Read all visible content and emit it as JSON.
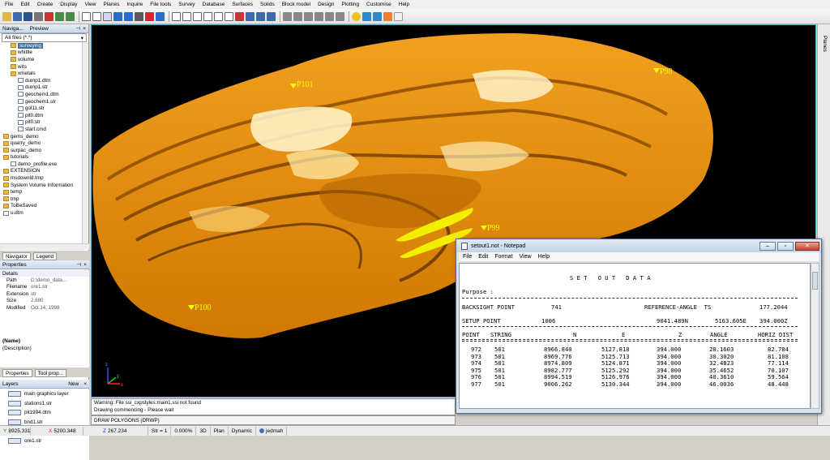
{
  "menu": [
    "File",
    "Edit",
    "Create",
    "Display",
    "View",
    "Planes",
    "Inquire",
    "File tools",
    "Survey",
    "Database",
    "Surfaces",
    "Solids",
    "Block model",
    "Design",
    "Plotting",
    "Customise",
    "Help"
  ],
  "navigator": {
    "title": "Naviga...",
    "preview_tab": "Preview",
    "filter": "All files (*.*)",
    "items": [
      {
        "label": "surveying",
        "kind": "folder",
        "indent": 1,
        "selected": true
      },
      {
        "label": "whittle",
        "kind": "folder",
        "indent": 1
      },
      {
        "label": "volume",
        "kind": "folder",
        "indent": 1
      },
      {
        "label": "wits",
        "kind": "folder",
        "indent": 1
      },
      {
        "label": "xmetals",
        "kind": "folder",
        "indent": 1
      },
      {
        "label": "dump1.dtm",
        "kind": "file",
        "indent": 2
      },
      {
        "label": "dump1.str",
        "kind": "file",
        "indent": 2
      },
      {
        "label": "geochem1.dtm",
        "kind": "file",
        "indent": 2
      },
      {
        "label": "geochem1.str",
        "kind": "file",
        "indent": 2
      },
      {
        "label": "gol11.str",
        "kind": "file",
        "indent": 2
      },
      {
        "label": "pit0.dtm",
        "kind": "file",
        "indent": 2
      },
      {
        "label": "pit0.str",
        "kind": "file",
        "indent": 2
      },
      {
        "label": "start.cmd",
        "kind": "file",
        "indent": 2
      },
      {
        "label": "gems_demo",
        "kind": "folder",
        "indent": 0
      },
      {
        "label": "quarry_demo",
        "kind": "folder",
        "indent": 0
      },
      {
        "label": "surpac_demo",
        "kind": "folder",
        "indent": 0
      },
      {
        "label": "tutorials",
        "kind": "folder",
        "indent": 0
      },
      {
        "label": "demo_profile.exe",
        "kind": "file",
        "indent": 1
      },
      {
        "label": "EXTENSION",
        "kind": "folder",
        "indent": 0
      },
      {
        "label": "msdownld.tmp",
        "kind": "folder",
        "indent": 0
      },
      {
        "label": "System Volume Information",
        "kind": "folder",
        "indent": 0
      },
      {
        "label": "temp",
        "kind": "folder",
        "indent": 0
      },
      {
        "label": "tmp",
        "kind": "folder",
        "indent": 0
      },
      {
        "label": "ToBeSaved",
        "kind": "folder",
        "indent": 0
      },
      {
        "label": "u.dtm",
        "kind": "file",
        "indent": 0
      }
    ]
  },
  "nav_tabs": [
    "Navigator",
    "Legend"
  ],
  "properties": {
    "title": "Properties",
    "section": "Details",
    "rows": [
      {
        "k": "Path",
        "v": "D:\\demo_data..."
      },
      {
        "k": "Filename",
        "v": "ore1.str"
      },
      {
        "k": "Extension",
        "v": "str"
      },
      {
        "k": "Size",
        "v": "2,680"
      },
      {
        "k": "Modified",
        "v": "Oct 14, 1998"
      }
    ],
    "name_label": "(Name)",
    "desc_label": "(Description)"
  },
  "prop_tabs": [
    "Properties",
    "Tool prop..."
  ],
  "layers": {
    "title": "Layers",
    "new_label": "New",
    "items": [
      {
        "label": "main graphics layer",
        "selected": false
      },
      {
        "label": "stations1.str",
        "selected": false
      },
      {
        "label": "pit1994.dtm",
        "selected": false
      },
      {
        "label": "bnd1.str",
        "selected": false
      },
      {
        "label": "new2.str",
        "selected": true
      },
      {
        "label": "ore1.str",
        "selected": false
      }
    ]
  },
  "viewport": {
    "point_labels": [
      "P101",
      "P98",
      "P99",
      "P100"
    ],
    "axis_labels": [
      "z",
      "y",
      "x"
    ]
  },
  "right_strip": {
    "label": "Planes"
  },
  "console": {
    "line1": "Warning: File ssi_cxpstyles:main1.ssi not found",
    "line2": "Drawing commencing - Please wait",
    "command": "DRAW POLYGONS (DRWP)"
  },
  "status": {
    "y": "8925.331",
    "x": "5200.348",
    "z": "267.234",
    "str": "Str = 1",
    "zoom": "0.000%",
    "mode3d": "3D",
    "plan": "Plan",
    "dynamic": "Dynamic",
    "user": "jedmah"
  },
  "notepad": {
    "title": "setout1.not - Notepad",
    "menu": [
      "File",
      "Edit",
      "Format",
      "View",
      "Help"
    ],
    "heading": "S E T   O U T   D A T A",
    "purpose": "Purpose :",
    "backsight_label": "BACKSIGHT POINT",
    "backsight_value": "741",
    "refangle_label": "REFERENCE-ANGLE  TS",
    "refangle_value": "177.2044",
    "setup_label": "SETUP POINT",
    "setup_id": "1006",
    "setup_n": "9041.489N",
    "setup_e": "5163.605E",
    "setup_z": "394.000Z",
    "columns": [
      "POINT",
      "STRING",
      "N",
      "E",
      "Z",
      "ANGLE",
      "HORIZ DIST"
    ],
    "rows": [
      [
        "972",
        "501",
        "8966.840",
        "5127.818",
        "394.000",
        "28.1603",
        "82.784"
      ],
      [
        "973",
        "501",
        "8969.776",
        "5125.713",
        "394.000",
        "30.3020",
        "81.108"
      ],
      [
        "974",
        "501",
        "8974.809",
        "5124.871",
        "394.000",
        "32.4823",
        "77.114"
      ],
      [
        "975",
        "501",
        "8982.777",
        "5125.292",
        "394.000",
        "35.4652",
        "70.107"
      ],
      [
        "976",
        "501",
        "8994.519",
        "5126.976",
        "394.000",
        "40.3610",
        "59.564"
      ],
      [
        "977",
        "501",
        "9006.262",
        "5130.344",
        "394.000",
        "46.0036",
        "48.448"
      ]
    ]
  }
}
